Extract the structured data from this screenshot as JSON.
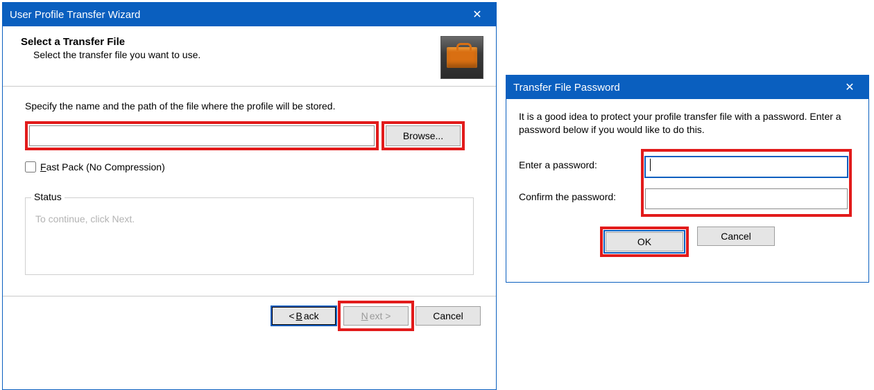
{
  "wizard": {
    "title": "User Profile Transfer Wizard",
    "heading": "Select a Transfer File",
    "subheading": "Select the transfer file you want to use.",
    "instruction": "Specify the name and the path of the file where the profile will be stored.",
    "path_value": "",
    "browse_label": "Browse...",
    "fastpack_label_pre": "F",
    "fastpack_label_rest": "ast Pack (No Compression)",
    "status_legend": "Status",
    "status_text": "To continue, click Next.",
    "back_pre": "< ",
    "back_u": "B",
    "back_post": "ack",
    "next_u": "N",
    "next_post": "ext >",
    "cancel_label": "Cancel"
  },
  "password_dialog": {
    "title": "Transfer File Password",
    "message": "It is a good idea to protect your profile transfer file with a password. Enter a password below if you would like to do this.",
    "enter_label": "Enter a password:",
    "confirm_label": "Confirm the password:",
    "enter_value": "",
    "confirm_value": "",
    "ok_label": "OK",
    "cancel_label": "Cancel"
  }
}
